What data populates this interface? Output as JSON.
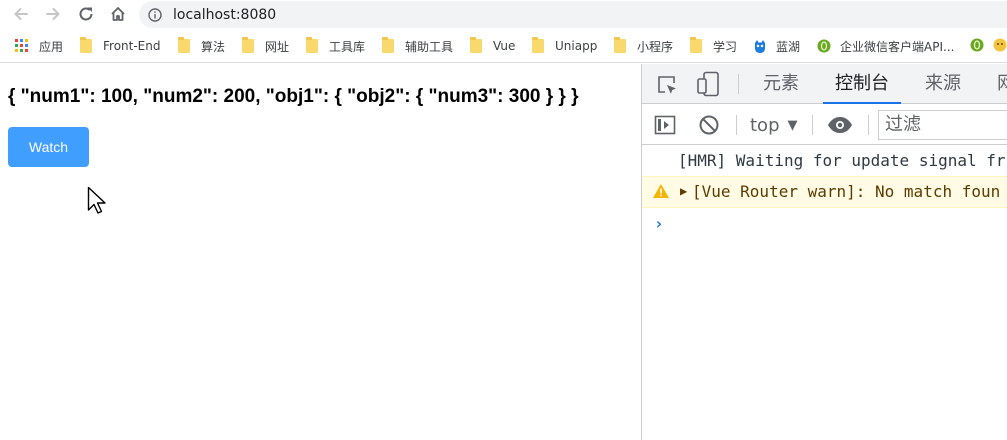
{
  "browser": {
    "url": "localhost:8080"
  },
  "bookmarks": [
    {
      "label": "应用",
      "icon": "apps-grid-icon"
    },
    {
      "label": "Front-End",
      "icon": "folder-icon"
    },
    {
      "label": "算法",
      "icon": "folder-icon"
    },
    {
      "label": "网址",
      "icon": "folder-icon"
    },
    {
      "label": "工具库",
      "icon": "folder-icon"
    },
    {
      "label": "辅助工具",
      "icon": "folder-icon"
    },
    {
      "label": "Vue",
      "icon": "folder-icon"
    },
    {
      "label": "Uniapp",
      "icon": "folder-icon"
    },
    {
      "label": "小程序",
      "icon": "folder-icon"
    },
    {
      "label": "学习",
      "icon": "folder-icon"
    },
    {
      "label": "蓝湖",
      "icon": "lanhu-icon"
    },
    {
      "label": "企业微信客户端API...",
      "icon": "green-circle-icon"
    }
  ],
  "page": {
    "json_text": "{ \"num1\": 100, \"num2\": 200, \"obj1\": { \"obj2\": { \"num3\": 300 } } }",
    "watch_label": "Watch",
    "button_color": "#409eff"
  },
  "devtools": {
    "tabs": [
      "元素",
      "控制台",
      "来源",
      "网"
    ],
    "active_tab": "控制台",
    "context": "top",
    "filter_placeholder": "过滤",
    "logs": [
      {
        "level": "info",
        "text": "[HMR] Waiting for update signal fr"
      },
      {
        "level": "warning",
        "text": "[Vue Router warn]: No match foun"
      }
    ],
    "prompt": "›"
  }
}
